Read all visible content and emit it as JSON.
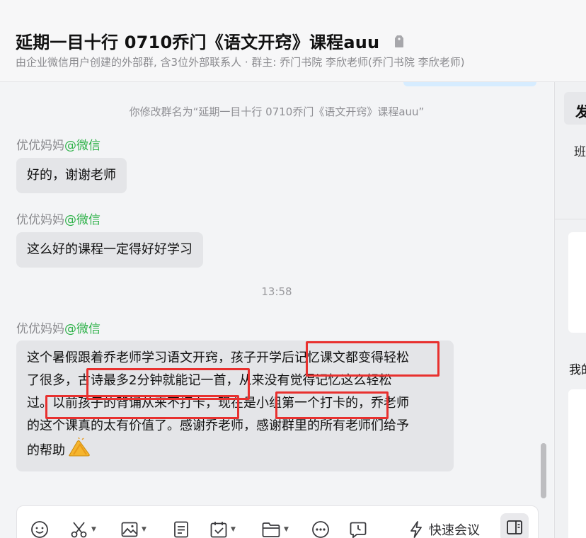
{
  "header": {
    "title": "延期一目十行 0710乔门《语文开窍》课程auu",
    "subtitle": "由企业微信用户创建的外部群, 含3位外部联系人 · 群主: 乔门书院 李欣老师(乔门书院 李欣老师)"
  },
  "messages": {
    "system_rename": "你修改群名为“延期一目十行 0710乔门《语文开窍》课程auu”",
    "m1": {
      "sender": "优优妈妈",
      "source": "@微信",
      "text": "好的，谢谢老师"
    },
    "m2": {
      "sender": "优优妈妈",
      "source": "@微信",
      "text": "这么好的课程一定得好好学习"
    },
    "time": "13:58",
    "m3": {
      "sender": "优优妈妈",
      "source": "@微信",
      "lines": [
        "这个暑假跟着乔老师学习语文开窍，孩子开学后记忆课文都变得轻松",
        "了很多，古诗最多2分钟就能记一首，从来没有觉得记忆这么轻松",
        "过。以前孩子的背诵从来不打卡，现在是小组第一个打卡的，乔老师",
        "的这个课真的太有价值了。感谢乔老师，感谢群里的所有老师们给予",
        "的帮助"
      ],
      "emoji": "clap-emoji"
    }
  },
  "toolbar": {
    "quick_meeting": "快速会议",
    "icons": [
      "smile-icon",
      "scissors-icon",
      "image-icon",
      "document-icon",
      "calendar-check-icon",
      "folder-icon",
      "more-icon",
      "clock-message-icon",
      "lightning-icon",
      "side-panel-icon"
    ]
  },
  "right_panel": {
    "top_label": "发",
    "sub_label": "班",
    "me_label": "我的"
  },
  "colors": {
    "highlight": "#e8312f",
    "wechat_green": "#2fb24a",
    "bubble_bg": "#e4e5e8"
  }
}
